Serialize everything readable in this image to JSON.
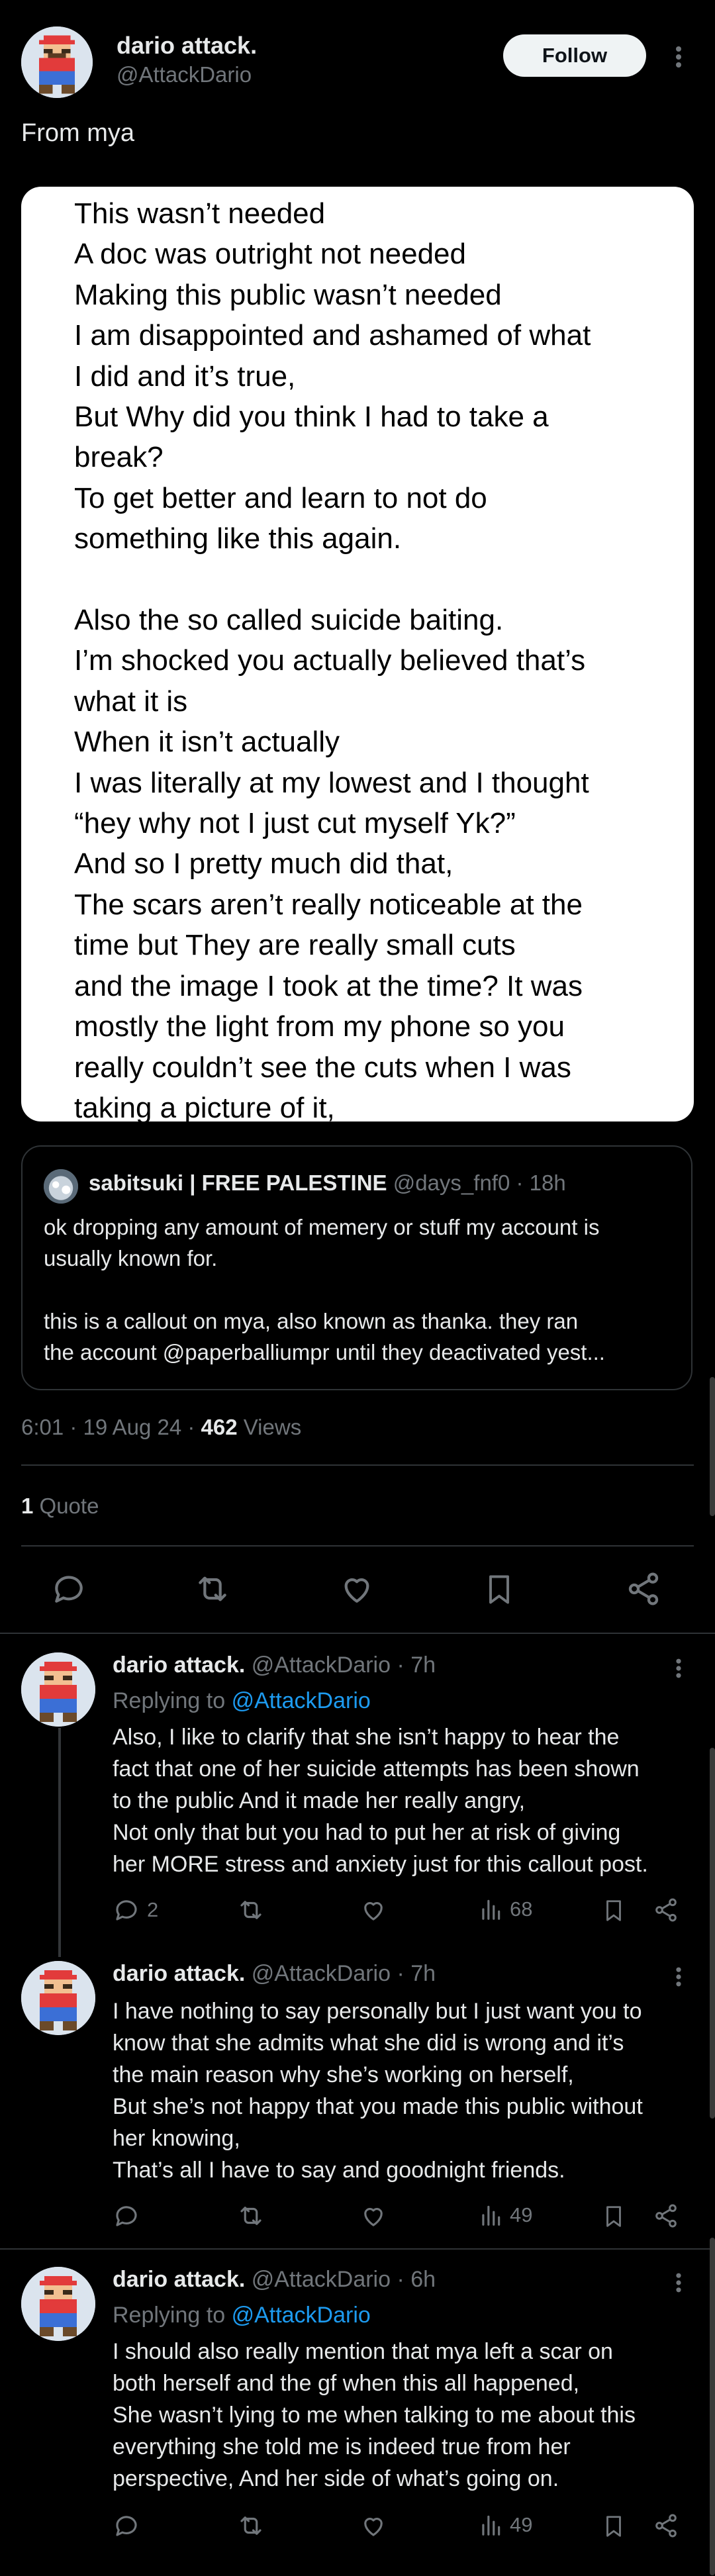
{
  "main_tweet": {
    "author_name": "dario attack.",
    "author_handle": "@AttackDario",
    "follow_label": "Follow",
    "text": "From mya",
    "image_text_lines": [
      "This wasn’t needed",
      "A doc was outright not needed",
      "Making this public wasn’t needed",
      "I am disappointed and ashamed of what",
      "I did and it’s true,",
      "But Why did you think I had to take a",
      "break?",
      "To get better and learn to not do",
      "something like this again.",
      "",
      "Also the so called suicide baiting.",
      "I’m shocked you actually believed that’s",
      "what it is",
      "When it isn’t actually",
      "I was literally at my lowest and I thought",
      "“hey why not I just cut myself Yk?”",
      "And so I pretty much did that,",
      "The scars aren’t really noticeable at the",
      "time but They are really small cuts",
      "and the image I took at the time? It was",
      "mostly the light from my phone so you",
      "really couldn’t see the cuts when I was",
      "taking a picture of it,"
    ],
    "quote": {
      "name": "sabitsuki | FREE PALESTINE",
      "handle": "@days_fnf0",
      "time": "· 18h",
      "line1": "ok dropping any amount of memery or stuff my account is",
      "line2": "usually known for.",
      "line3": "this is a callout on mya, also known as thanka. they ran",
      "line4": "the account @paperballiumpr until they deactivated yest..."
    },
    "timestamp": "6:01 · 19 Aug 24 ·",
    "views_count": "462",
    "views_label": "Views",
    "quotes_count": "1",
    "quotes_label": "Quote"
  },
  "replies": [
    {
      "name": "dario attack.",
      "handle": "@AttackDario",
      "time": "· 7h",
      "replying_label": "Replying to",
      "replying_handle": "@AttackDario",
      "lines": [
        "Also, I like to clarify that she isn’t happy to hear the",
        "fact that one of her suicide attempts has been shown",
        "to the public And it made her really angry,",
        "Not only that but you had to put her at risk of giving",
        "her MORE stress and anxiety just for this callout post."
      ],
      "reply_count": "2",
      "views": "68"
    },
    {
      "name": "dario attack.",
      "handle": "@AttackDario",
      "time": "· 7h",
      "lines": [
        "I have nothing to say personally but I just want you to",
        "know that she admits what she did is wrong and it’s",
        "the main reason why she’s working on herself,",
        "But she’s not happy that you made this public without",
        "her knowing,",
        "That’s all I have to say and goodnight friends."
      ],
      "views": "49"
    },
    {
      "name": "dario attack.",
      "handle": "@AttackDario",
      "time": "· 6h",
      "replying_label": "Replying to",
      "replying_handle": "@AttackDario",
      "lines": [
        "I should also really mention that mya left a scar on",
        "both herself and the gf when this all happened,",
        "She wasn’t lying to me when talking to me about this",
        "everything she told me is indeed true from her",
        "perspective, And her side of what’s going on."
      ],
      "views": "49"
    }
  ],
  "icons": {
    "avatar": "pixel-mario-avatar",
    "more": "more-dots-icon",
    "reply": "reply-icon",
    "repost": "repost-icon",
    "like": "like-icon",
    "bookmark": "bookmark-icon",
    "share": "share-icon",
    "views": "views-icon"
  },
  "colors": {
    "background": "#000000",
    "text": "#e7e9ea",
    "muted": "#71767b",
    "link": "#1d9bf0",
    "divider": "#2f3336"
  }
}
